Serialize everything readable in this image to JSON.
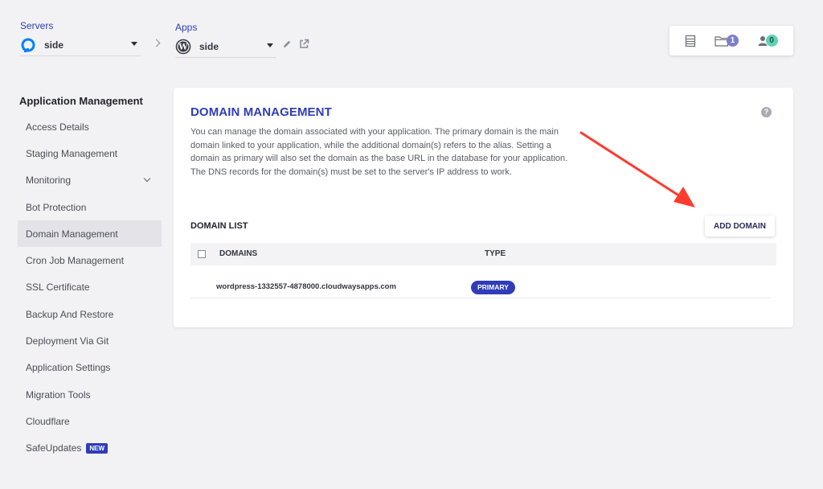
{
  "header": {
    "servers": {
      "label": "Servers",
      "selected": "side",
      "icon": "digitalocean-logo-icon"
    },
    "apps": {
      "label": "Apps",
      "selected": "side",
      "icon": "wordpress-logo-icon"
    },
    "actions": [
      "edit-pencil-icon",
      "external-link-icon"
    ],
    "counters": [
      {
        "icon": "server-list-icon",
        "count": ""
      },
      {
        "icon": "folder-icon",
        "count": "1"
      },
      {
        "icon": "team-user-icon",
        "count": "0"
      }
    ]
  },
  "sidebar": {
    "heading": "Application Management",
    "items": [
      {
        "label": "Access Details"
      },
      {
        "label": "Staging Management"
      },
      {
        "label": "Monitoring"
      },
      {
        "label": "Bot Protection"
      },
      {
        "label": "Domain Management"
      },
      {
        "label": "Cron Job Management"
      },
      {
        "label": "SSL Certificate"
      },
      {
        "label": "Backup And Restore"
      },
      {
        "label": "Deployment Via Git"
      },
      {
        "label": "Application Settings"
      },
      {
        "label": "Migration Tools"
      },
      {
        "label": "Cloudflare"
      },
      {
        "label": "SafeUpdates",
        "badge": "NEW"
      }
    ],
    "active_item": "Domain Management"
  },
  "main": {
    "title": "DOMAIN MANAGEMENT",
    "help_icon": "?",
    "description": "You can manage the domain associated with your application. The primary domain is the main domain linked to your application, while the additional domain(s) refers to the alias. Setting a domain as primary will also set the domain as the base URL in the database for your application. The DNS records for the domain(s) must be set to the server's IP address to work.",
    "domain_list": {
      "title": "DOMAIN LIST",
      "add_button": "ADD DOMAIN",
      "columns": [
        "DOMAINS",
        "TYPE"
      ],
      "rows": [
        {
          "domain": "wordpress-1332557-4878000.cloudwaysapps.com",
          "type": "PRIMARY"
        }
      ]
    }
  },
  "colors": {
    "accent": "#2f3db8",
    "annotation_arrow": "#ff3b30",
    "badge_purple": "#7d7fc8",
    "badge_teal": "#5ed3b4"
  }
}
